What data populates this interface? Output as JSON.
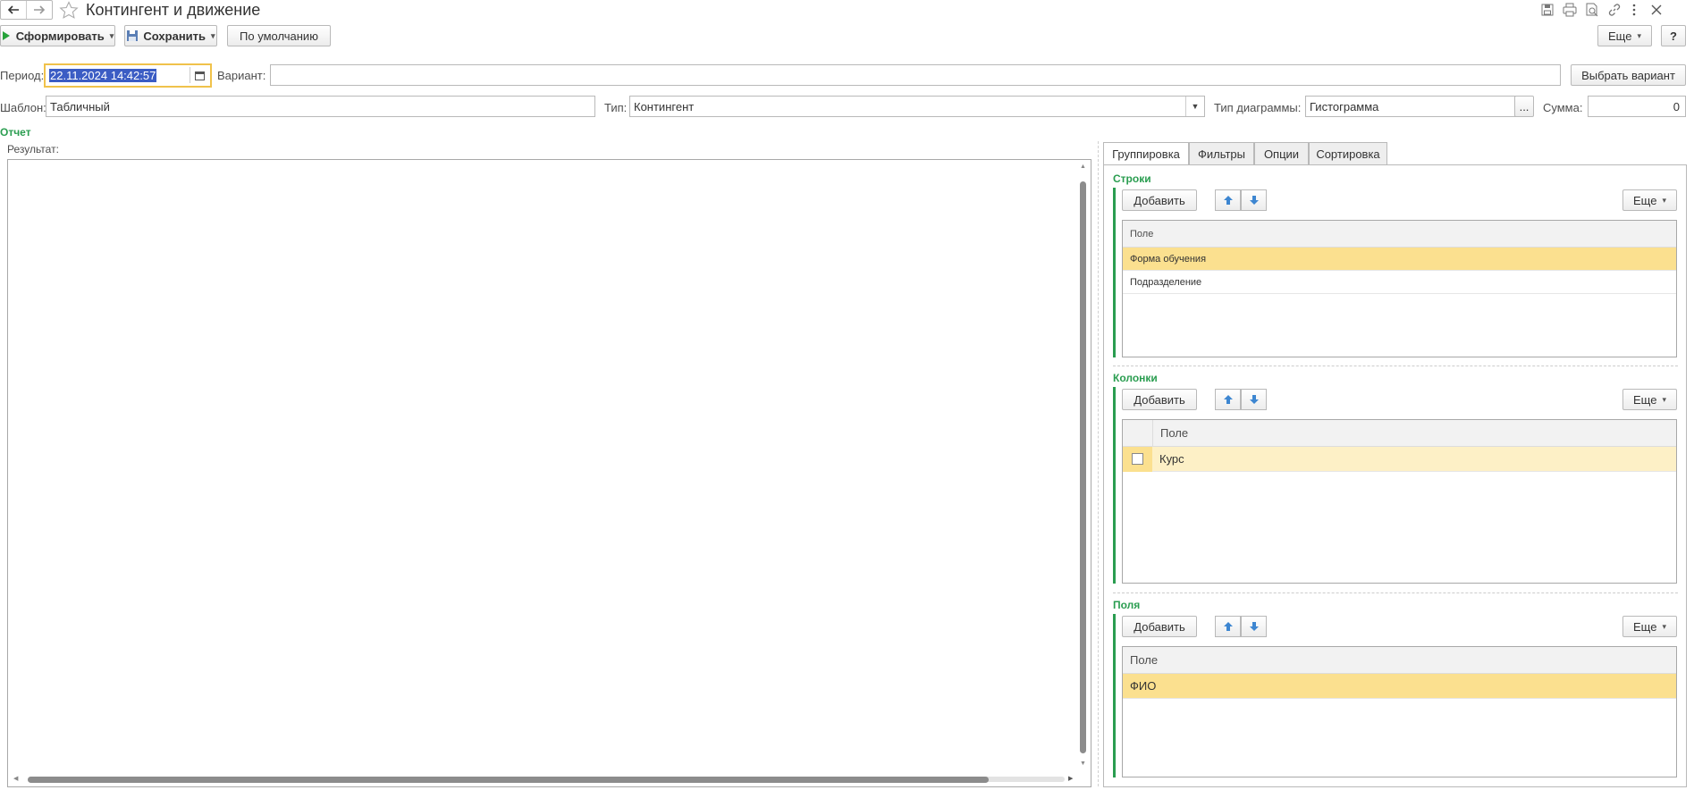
{
  "window": {
    "title": "Контингент и движение"
  },
  "toolbar": {
    "generate_label": "Сформировать",
    "save_label": "Сохранить",
    "default_label": "По умолчанию",
    "more_label": "Еще",
    "help_label": "?"
  },
  "params": {
    "period_label": "Период:",
    "period_value": "22.11.2024 14:42:57",
    "variant_label": "Вариант:",
    "variant_value": "",
    "choose_variant_label": "Выбрать вариант",
    "template_label": "Шаблон:",
    "template_value": "Табличный",
    "type_label": "Тип:",
    "type_value": "Контингент",
    "chart_type_label": "Тип диаграммы:",
    "chart_type_value": "Гистограмма",
    "ellipsis": "...",
    "sum_label": "Сумма:",
    "sum_value": "0"
  },
  "report": {
    "group_label": "Отчет",
    "result_label": "Результат:"
  },
  "settings": {
    "tabs": [
      "Группировка",
      "Фильтры",
      "Опции",
      "Сортировка"
    ],
    "rows": {
      "title": "Строки",
      "add_label": "Добавить",
      "more_label": "Еще",
      "column_header": "Поле",
      "items": [
        "Форма обучения",
        "Подразделение"
      ]
    },
    "columns": {
      "title": "Колонки",
      "add_label": "Добавить",
      "more_label": "Еще",
      "column_header": "Поле",
      "items": [
        "Курс"
      ]
    },
    "fields": {
      "title": "Поля",
      "add_label": "Добавить",
      "more_label": "Еще",
      "column_header": "Поле",
      "items": [
        "ФИО"
      ]
    }
  },
  "colors": {
    "accent_green": "#2a9d50",
    "selection": "#fbe08f",
    "period_highlight": "#3b5cc4"
  }
}
